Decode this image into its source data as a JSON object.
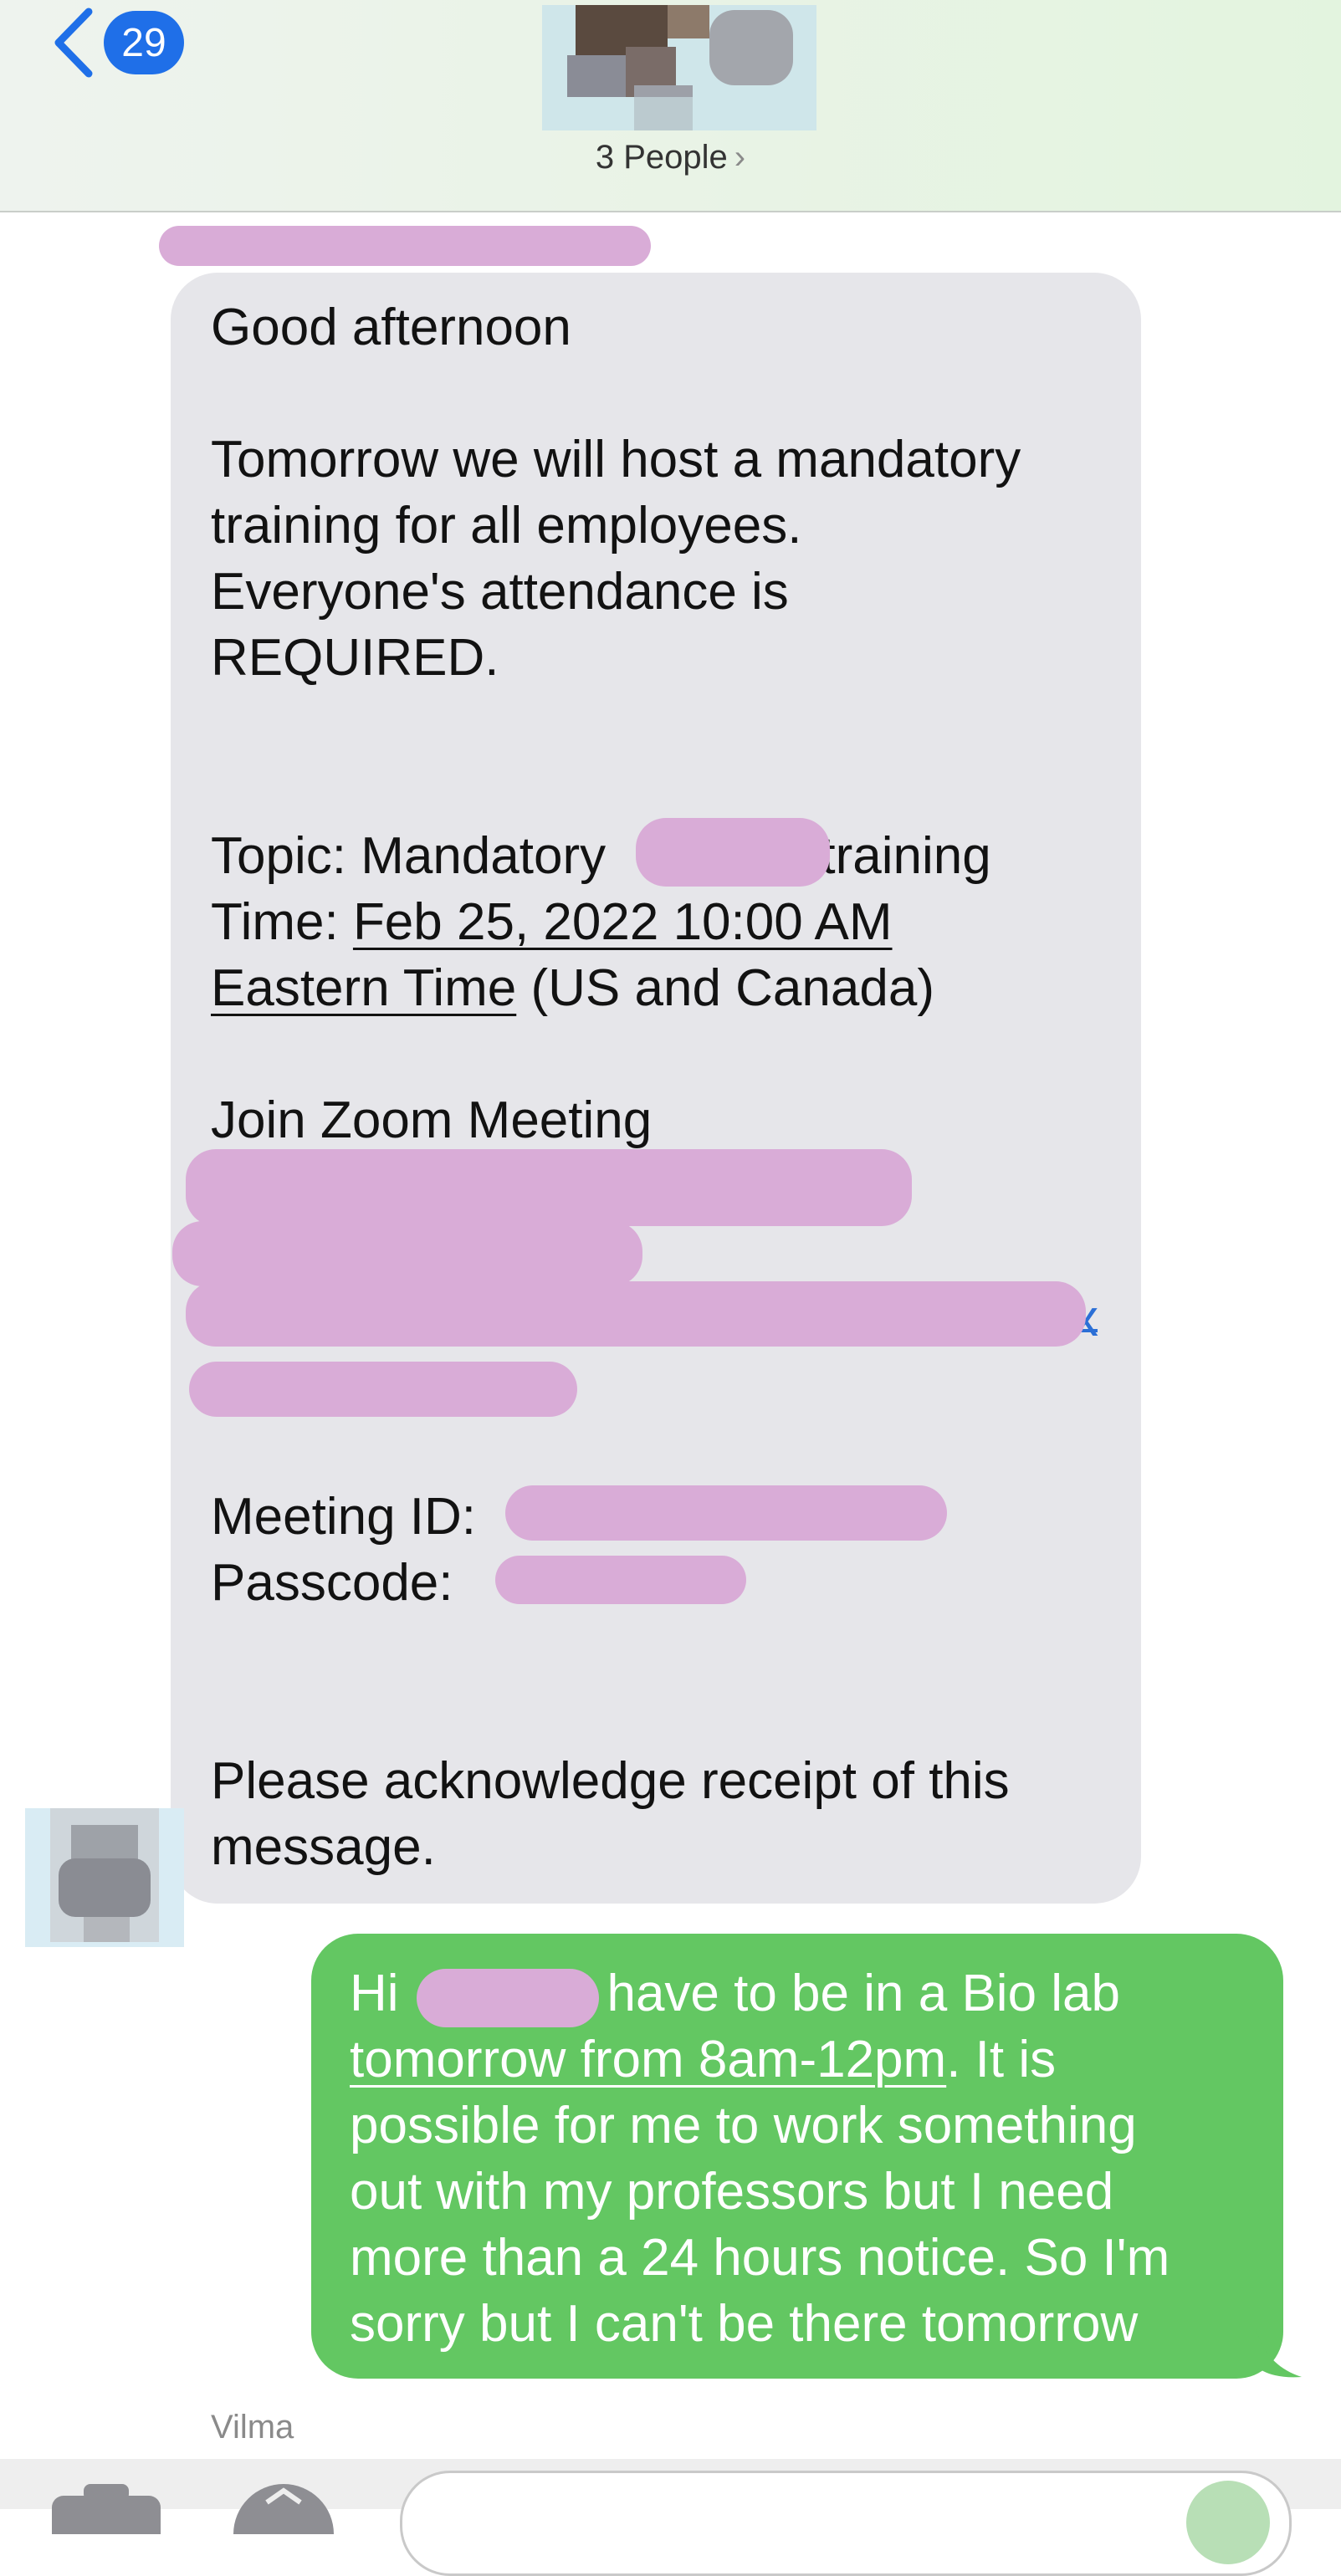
{
  "header": {
    "back_count": "29",
    "people_label": "3 People",
    "chevron": "›"
  },
  "incoming_message": {
    "greeting": "Good afternoon",
    "para1_line1": "Tomorrow we will host a mandatory",
    "para1_line2": "training for all employees.",
    "para1_line3": "Everyone's attendance is",
    "para1_line4": "REQUIRED.",
    "topic_prefix": "Topic: Mandatory ",
    "topic_suffix": "training",
    "time_prefix": "Time: ",
    "time_date": "Feb 25, 2022 10:00 AM",
    "time_zone_link": "Eastern Time",
    "time_zone_rest": " (US and Canada)",
    "join_heading": "Join Zoom Meeting",
    "link_tail": "x",
    "meeting_id_label": "Meeting ID:",
    "passcode_label": "Passcode:",
    "closing_line1": "Please acknowledge receipt of this",
    "closing_line2": "message."
  },
  "outgoing_message": {
    "line1_prefix": "Hi ",
    "line1_suffix": " I have to be in a Bio lab",
    "line2_link": "tomorrow from 8am-12pm",
    "line2_rest": ". It is",
    "line3": "possible for me to work something",
    "line4": "out with my professors but I need",
    "line5": "more than a 24 hours notice. So I'm",
    "line6": "sorry but I can't be there tomorrow"
  },
  "sender_name": "Vilma",
  "colors": {
    "incoming_bubble": "#e6e6ea",
    "outgoing_bubble": "#63c762",
    "badge": "#1f6fe8",
    "link": "#2b6fd6",
    "redaction": "#d9acd7"
  },
  "icons": [
    "back-chevron-icon",
    "camera-icon",
    "app-store-icon"
  ]
}
